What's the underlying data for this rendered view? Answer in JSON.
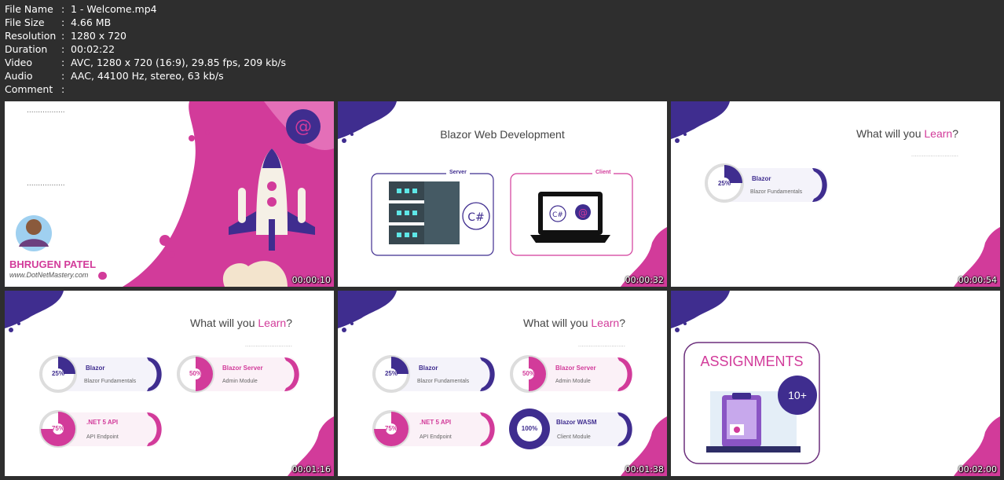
{
  "info": {
    "rows": [
      {
        "key": "File Name",
        "value": "1 - Welcome.mp4"
      },
      {
        "key": "File Size",
        "value": "4.66 MB"
      },
      {
        "key": "Resolution",
        "value": "1280 x 720"
      },
      {
        "key": "Duration",
        "value": "00:02:22"
      },
      {
        "key": "Video",
        "value": "AVC, 1280 x 720 (16:9), 29.85 fps, 209 kb/s"
      },
      {
        "key": "Audio",
        "value": "AAC, 44100 Hz, stereo, 63 kb/s"
      },
      {
        "key": "Comment",
        "value": ""
      }
    ],
    "separator": ":"
  },
  "thumbs": [
    {
      "timestamp": "00:00:10",
      "presenter_name": "BHRUGEN PATEL",
      "presenter_site": "www.DotNetMastery.com"
    },
    {
      "timestamp": "00:00:32",
      "title": "Blazor Web Development",
      "server_label": "Server",
      "client_label": "Client",
      "csharp": "C#"
    },
    {
      "timestamp": "00:00:54",
      "title_plain": "What will you ",
      "title_accent": "Learn",
      "title_end": "?",
      "cards": [
        {
          "pct": "25%",
          "name": "Blazor",
          "sub": "Blazor Fundamentals"
        }
      ]
    },
    {
      "timestamp": "00:01:16",
      "title_plain": "What will you ",
      "title_accent": "Learn",
      "title_end": "?",
      "cards": [
        {
          "pct": "25%",
          "name": "Blazor",
          "sub": "Blazor Fundamentals"
        },
        {
          "pct": "50%",
          "name": "Blazor Server",
          "sub": "Admin Module"
        },
        {
          "pct": "75%",
          "name": ".NET 5 API",
          "sub": "API Endpoint"
        }
      ]
    },
    {
      "timestamp": "00:01:38",
      "title_plain": "What will you ",
      "title_accent": "Learn",
      "title_end": "?",
      "cards": [
        {
          "pct": "25%",
          "name": "Blazor",
          "sub": "Blazor Fundamentals"
        },
        {
          "pct": "50%",
          "name": "Blazor Server",
          "sub": "Admin Module"
        },
        {
          "pct": "75%",
          "name": ".NET 5 API",
          "sub": "API Endpoint"
        },
        {
          "pct": "100%",
          "name": "Blazor WASM",
          "sub": "Client Module"
        }
      ]
    },
    {
      "timestamp": "00:02:00",
      "heading": "ASSIGNMENTS",
      "count": "10+"
    }
  ],
  "colors": {
    "purple": "#3f2d8f",
    "pink": "#d23b9a",
    "bg": "#2e2e2e"
  }
}
